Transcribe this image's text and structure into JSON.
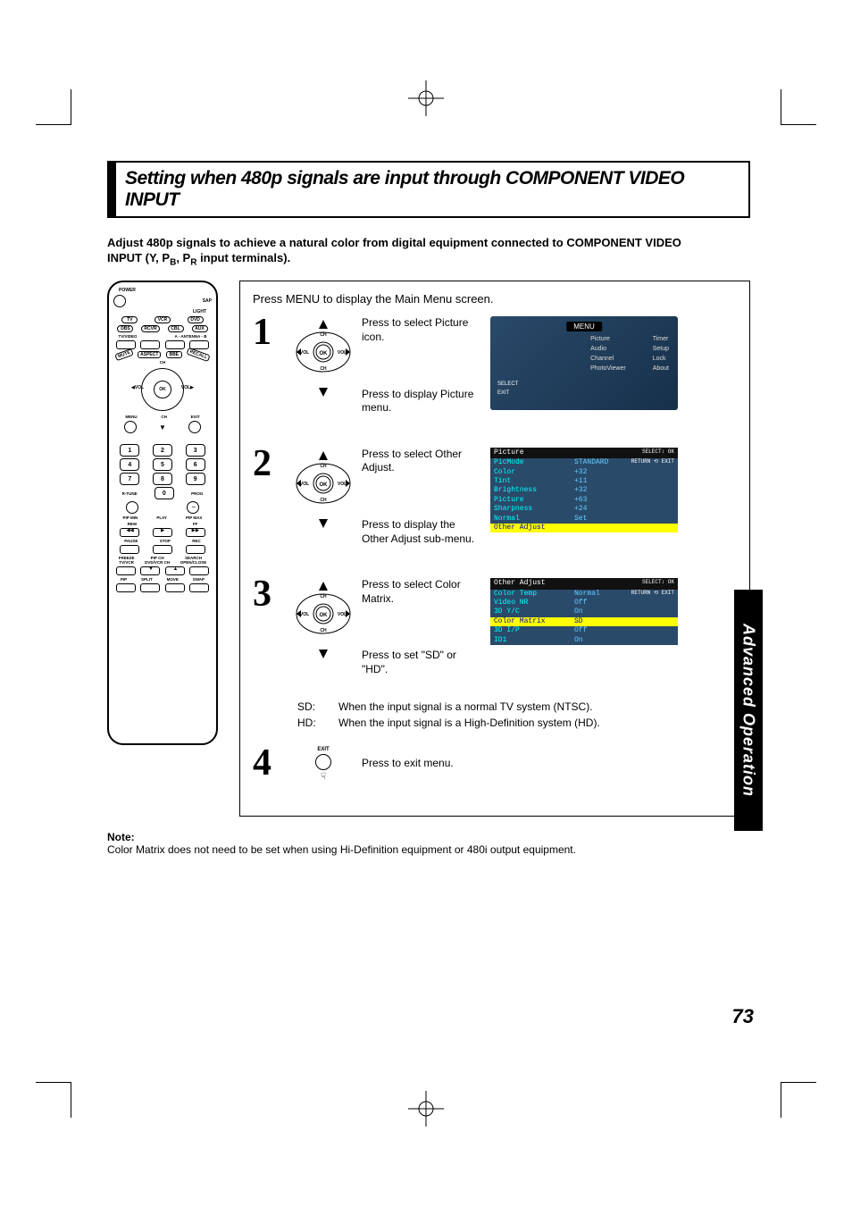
{
  "title": "Setting when 480p signals are input through COMPONENT VIDEO INPUT",
  "intro_line1": "Adjust 480p signals to achieve a natural color from digital equipment connected to COMPONENT VIDEO",
  "intro_line2": "INPUT (Y, P",
  "intro_sub1": "B",
  "intro_mid": ", P",
  "intro_sub2": "R",
  "intro_end": " input terminals).",
  "remote": {
    "power": "POWER",
    "sap": "SAP",
    "light": "LIGHT",
    "row1": [
      "TV",
      "VCR",
      "DVD"
    ],
    "row2": [
      "DBS",
      "RCVR",
      "CBL",
      "AUX"
    ],
    "tvvideo": "TV/VIDEO",
    "antenna": "A - ANTENNA - B",
    "ring_top": [
      "MUTE",
      "ASPECT",
      "BBE",
      "RECALL"
    ],
    "ch": "CH",
    "vol": "VOL",
    "ok": "OK",
    "menu": "MENU",
    "exit": "EXIT",
    "nums": [
      "1",
      "2",
      "3",
      "4",
      "5",
      "6",
      "7",
      "8",
      "9",
      "0"
    ],
    "rtune": "R-TUNE",
    "prog": "PROG",
    "pipmin": "PIP MIN",
    "play": "PLAY",
    "pipmax": "PIP MAX",
    "rew": "REW",
    "ff": "FF",
    "pause": "PAUSE",
    "stop": "STOP",
    "rec": "REC",
    "freeze": "FREEZE",
    "tvvcr": "TV/VCR",
    "pipch": "PIP CH",
    "dvdvcrch": "DVD/VCR CH",
    "search": "SEARCH",
    "openclose": "OPEN/CLOSE",
    "pip": "PIP",
    "split": "SPLIT",
    "move": "MOVE",
    "swap": "SWAP"
  },
  "steps": {
    "top": "Press MENU to display the Main Menu screen.",
    "s1": {
      "num": "1",
      "t1": "Press to select Picture icon.",
      "t2": "Press to display Picture menu."
    },
    "s2": {
      "num": "2",
      "t1": "Press to select Other Adjust.",
      "t2": "Press to display the Other Adjust sub-menu."
    },
    "s3": {
      "num": "3",
      "t1": "Press to select Color Matrix.",
      "t2": "Press to set \"SD\" or \"HD\".",
      "sd_k": "SD:",
      "sd_v": "When the input signal is a normal TV system (NTSC).",
      "hd_k": "HD:",
      "hd_v": "When the input signal is a High-Definition system (HD)."
    },
    "s4": {
      "num": "4",
      "exit": "EXIT",
      "t1": "Press to exit menu."
    }
  },
  "osd": {
    "menu_title": "MENU",
    "menu_items": [
      "Picture",
      "Timer",
      "Audio",
      "Setup",
      "Channel",
      "Lock",
      "PhotoViewer",
      "About"
    ],
    "select": "SELECT",
    "ok": "OK",
    "exit_lbl": "EXIT",
    "return": "RETURN",
    "picture": {
      "title": "Picture",
      "rows": [
        [
          "PicMode",
          "STANDARD"
        ],
        [
          "Color",
          "+32"
        ],
        [
          "Tint",
          "+11"
        ],
        [
          "Brightness",
          "+32"
        ],
        [
          "Picture",
          "+63"
        ],
        [
          "Sharpness",
          "+24"
        ],
        [
          "Normal",
          "Set"
        ]
      ],
      "hl": "Other Adjust"
    },
    "other": {
      "title": "Other Adjust",
      "rows": [
        [
          "Color Temp",
          "Normal"
        ],
        [
          "Video NR",
          "Off"
        ],
        [
          "3D Y/C",
          "On"
        ]
      ],
      "hl": [
        "Color Matrix",
        "SD"
      ],
      "rows2": [
        [
          "3D I/P",
          "Off"
        ],
        [
          "ID1",
          "On"
        ]
      ]
    }
  },
  "note_label": "Note:",
  "note_text": "Color Matrix does not need to be set when using Hi-Definition equipment or 480i output equipment.",
  "side_tab": "Advanced Operation",
  "page_num": "73",
  "nav_labels": {
    "ch": "CH",
    "vol": "VOL",
    "ok": "OK"
  }
}
